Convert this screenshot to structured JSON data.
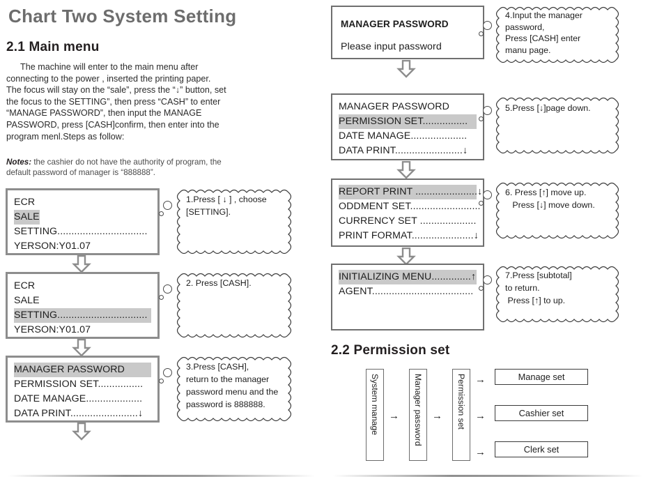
{
  "document": {
    "title": "Chart Two System Setting",
    "accent_gray": "#6d6d6d",
    "highlight_gray": "#c9c9c9"
  },
  "section_21": {
    "heading": "2.1 Main menu",
    "paragraph": "The machine will enter to the main menu after connecting to the power , inserted the printing paper. The focus will stay on the “sale”, press the “↓” button, set the focus to the SETTING”, then press “CASH” to enter “MANAGE PASSWORD”, then input the MANAGE PASSWORD, press [CASH]confirm, then enter into the program menl.Steps as follow:",
    "notes_label": "Notes:",
    "notes_text": "the cashier do not have the authority of program, the default password of manager is “888888”."
  },
  "section_22": {
    "heading": "2.2 Permission set",
    "flow": {
      "stage_1": "System manage",
      "stage_2": "Manager password",
      "stage_3": "Permission set",
      "outputs": [
        "Manage set",
        "Cashier set",
        "Clerk set"
      ],
      "arrow_glyph": "→"
    }
  },
  "arrow_down_glyph": "⇩",
  "screens": [
    {
      "id": "screen-1",
      "lines": [
        {
          "text": "ECR",
          "highlighted": false
        },
        {
          "text": "SALE",
          "highlighted": true
        },
        {
          "text": "SETTING................................",
          "highlighted": false
        },
        {
          "text": "YERSON:Y01.07",
          "highlighted": false
        }
      ]
    },
    {
      "id": "screen-2",
      "lines": [
        {
          "text": "ECR",
          "highlighted": false
        },
        {
          "text": "SALE",
          "highlighted": false
        },
        {
          "text": "SETTING................................",
          "highlighted": true
        },
        {
          "text": "YERSON:Y01.07",
          "highlighted": false
        }
      ]
    },
    {
      "id": "screen-3",
      "lines": [
        {
          "text": "MANAGER PASSWORD",
          "highlighted": true
        },
        {
          "text": "PERMISSION SET................",
          "highlighted": false
        },
        {
          "text": "DATE MANAGE....................",
          "highlighted": false
        },
        {
          "text": "DATA  PRINT........................↓",
          "highlighted": false
        }
      ]
    },
    {
      "id": "screen-4",
      "lines": [
        {
          "text": "MANAGER PASSWORD",
          "highlighted": false,
          "bold": true
        },
        {
          "text": "Please input password",
          "highlighted": false
        }
      ]
    },
    {
      "id": "screen-5",
      "lines": [
        {
          "text": "MANAGER PASSWORD",
          "highlighted": false
        },
        {
          "text": "PERMISSION SET................",
          "highlighted": true
        },
        {
          "text": "DATE MANAGE....................",
          "highlighted": false
        },
        {
          "text": "DATA  PRINT........................↓",
          "highlighted": false
        }
      ]
    },
    {
      "id": "screen-6",
      "lines": [
        {
          "text": "REPORT PRINT ......................↓",
          "highlighted": true
        },
        {
          "text": "ODDMENT SET.........................",
          "highlighted": false
        },
        {
          "text": "CURRENCY SET ....................",
          "highlighted": false
        },
        {
          "text": "PRINT FORMAT......................↓",
          "highlighted": false
        }
      ]
    },
    {
      "id": "screen-7",
      "lines": [
        {
          "text": "INITIALIZING MENU..............↑",
          "highlighted": true
        },
        {
          "text": "AGENT....................................",
          "highlighted": false
        }
      ]
    }
  ],
  "callouts": [
    {
      "id": "callout-1",
      "line1": "1.Press [ ↓ ] , choose",
      "line2": "[SETTING].",
      "line3": "",
      "line4": ""
    },
    {
      "id": "callout-2",
      "line1": "2. Press [CASH].",
      "line2": "",
      "line3": "",
      "line4": ""
    },
    {
      "id": "callout-3",
      "line1": "3.Press [CASH],",
      "line2": "return to the manager",
      "line3": "password menu and the",
      "line4": "password is 888888."
    },
    {
      "id": "callout-4",
      "line1": "4.Input the manager",
      "line2": "password,",
      "line3": "Press [CASH]  enter",
      "line4": "manu page."
    },
    {
      "id": "callout-5",
      "line1": "5.Press [↓]page down.",
      "line2": "",
      "line3": "",
      "line4": ""
    },
    {
      "id": "callout-6",
      "line1": "6. Press [↑] move up.",
      "line2": "   Press [↓] move down.",
      "line3": "",
      "line4": ""
    },
    {
      "id": "callout-7",
      "line1": "7.Press [subtotal]",
      "line2": "to return.",
      "line3": " Press [↑]  to up.",
      "line4": ""
    }
  ]
}
